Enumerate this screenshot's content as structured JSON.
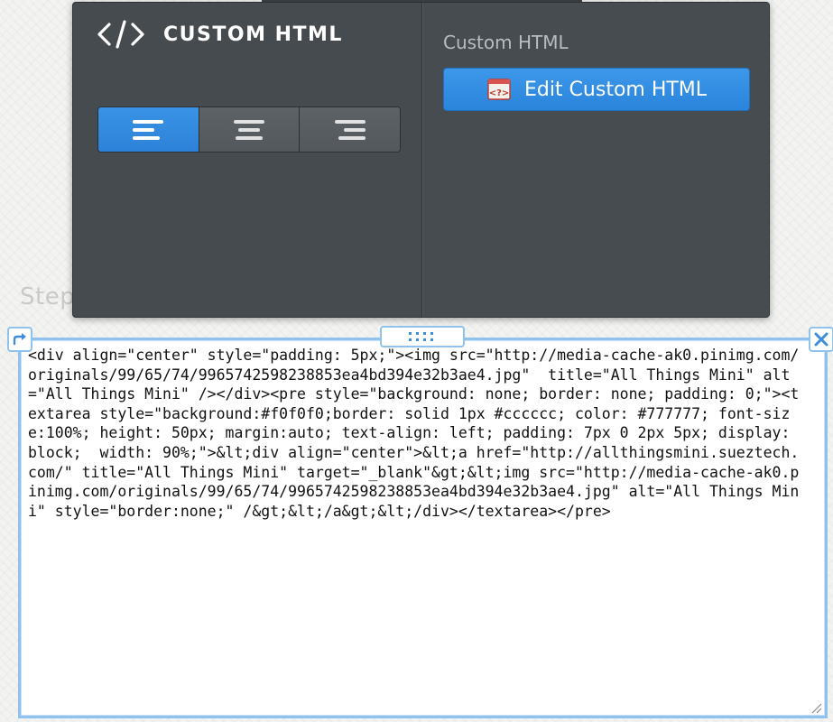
{
  "background": {
    "heading_partial": "Step"
  },
  "panel": {
    "title": "CUSTOM HTML",
    "title_icon": "code-icon",
    "alignment": {
      "options": [
        {
          "name": "align-left",
          "icon": "align-left-icon",
          "active": true
        },
        {
          "name": "align-center",
          "icon": "align-center-icon",
          "active": false
        },
        {
          "name": "align-right",
          "icon": "align-right-icon",
          "active": false
        }
      ]
    },
    "right": {
      "section_label": "Custom HTML",
      "edit_button_label": "Edit Custom HTML",
      "edit_button_icon": "html-file-icon"
    }
  },
  "editor": {
    "content": "<div align=\"center\" style=\"padding: 5px;\"><img src=\"http://media-cache-ak0.pinimg.com/originals/99/65/74/9965742598238853ea4bd394e32b3ae4.jpg\"  title=\"All Things Mini\" alt=\"All Things Mini\" /></div><pre style=\"background: none; border: none; padding: 0;\"><textarea style=\"background:#f0f0f0;border: solid 1px #cccccc; color: #777777; font-size:100%; height: 50px; margin:auto; text-align: left; padding: 7px 0 2px 5px; display: block;  width: 90%;\">&lt;div align=\"center\">&lt;a href=\"http://allthingsmini.sueztech.com/\" title=\"All Things Mini\" target=\"_blank\"&gt;&lt;img src=\"http://media-cache-ak0.pinimg.com/originals/99/65/74/9965742598238853ea4bd394e32b3ae4.jpg\" alt=\"All Things Mini\" style=\"border:none;\" /&gt;&lt;/a&gt;&lt;/div></textarea></pre>",
    "handle_icon": "drag-dots-icon",
    "left_control_icon": "arrow-redirect-icon",
    "right_control_icon": "close-icon"
  },
  "colors": {
    "panel_bg": "#464b4f",
    "accent_blue": "#2c82d8",
    "editor_border": "#8fc3ee"
  }
}
